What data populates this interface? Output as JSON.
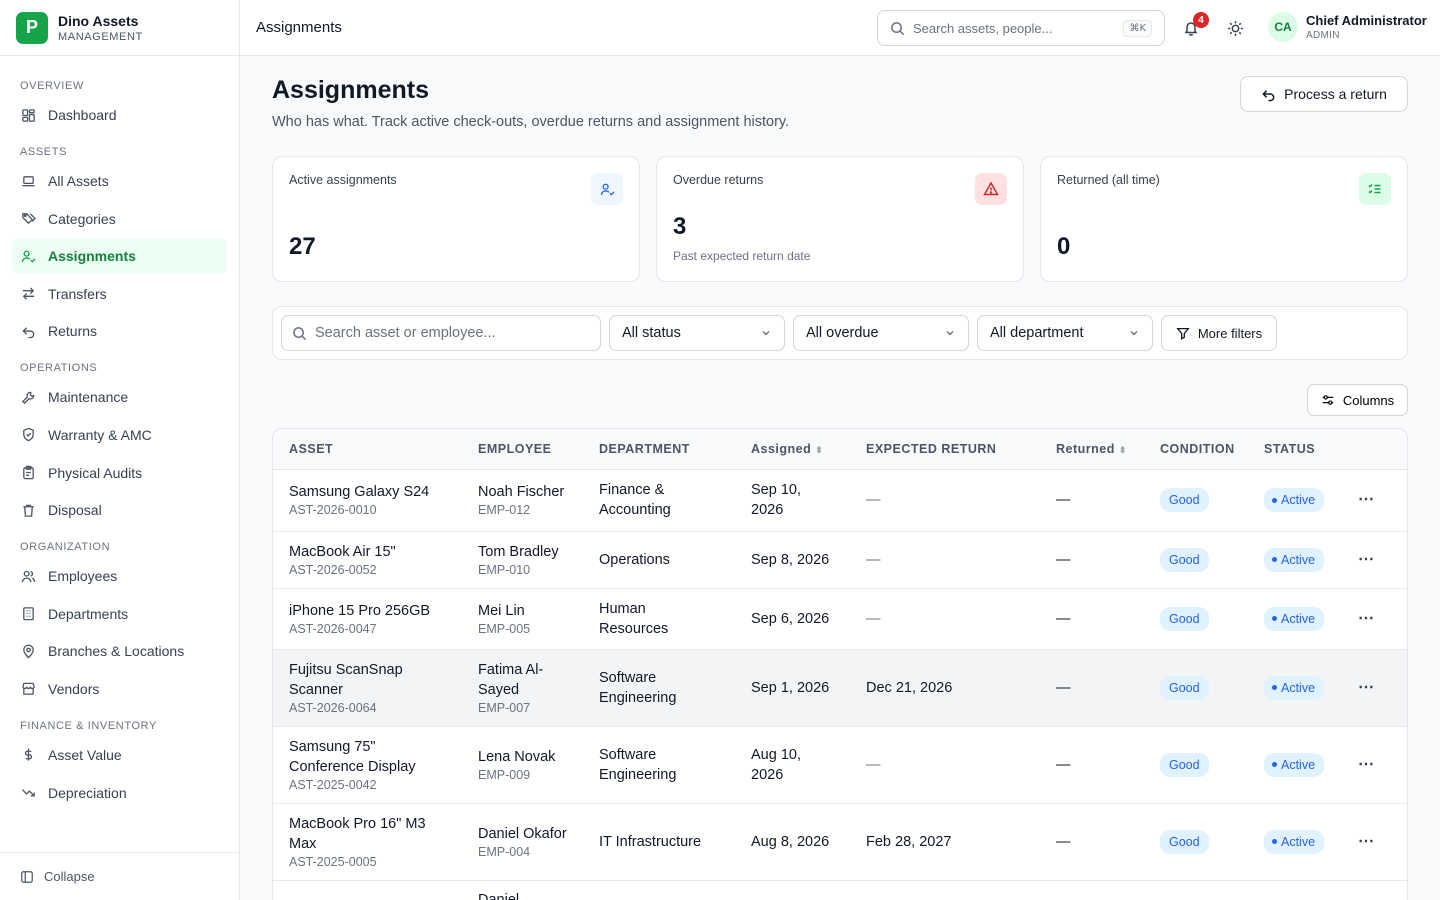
{
  "brand": {
    "logo_letter": "P",
    "name": "Dino Assets",
    "tagline": "MANAGEMENT"
  },
  "sidebar": {
    "sections": [
      {
        "title": "OVERVIEW",
        "items": [
          {
            "label": "Dashboard",
            "icon": "dashboard-icon"
          }
        ]
      },
      {
        "title": "ASSETS",
        "items": [
          {
            "label": "All Assets",
            "icon": "laptop-icon"
          },
          {
            "label": "Categories",
            "icon": "tags-icon"
          },
          {
            "label": "Assignments",
            "icon": "user-check-icon",
            "active": true
          },
          {
            "label": "Transfers",
            "icon": "arrows-icon"
          },
          {
            "label": "Returns",
            "icon": "undo-icon"
          }
        ]
      },
      {
        "title": "OPERATIONS",
        "items": [
          {
            "label": "Maintenance",
            "icon": "wrench-icon"
          },
          {
            "label": "Warranty & AMC",
            "icon": "shield-icon"
          },
          {
            "label": "Physical Audits",
            "icon": "clipboard-icon"
          },
          {
            "label": "Disposal",
            "icon": "trash-icon"
          }
        ]
      },
      {
        "title": "ORGANIZATION",
        "items": [
          {
            "label": "Employees",
            "icon": "users-icon"
          },
          {
            "label": "Departments",
            "icon": "building-icon"
          },
          {
            "label": "Branches & Locations",
            "icon": "map-pin-icon"
          },
          {
            "label": "Vendors",
            "icon": "store-icon"
          }
        ]
      },
      {
        "title": "FINANCE & INVENTORY",
        "items": [
          {
            "label": "Asset Value",
            "icon": "dollar-icon"
          },
          {
            "label": "Depreciation",
            "icon": "trending-down-icon"
          }
        ]
      }
    ],
    "collapse_label": "Collapse"
  },
  "header": {
    "breadcrumb": "Assignments",
    "search_placeholder": "Search assets, people...",
    "shortcut": "⌘K",
    "notification_count": "4",
    "user_initials": "CA",
    "user_name": "Chief Administrator",
    "user_role": "ADMIN"
  },
  "page": {
    "title": "Assignments",
    "subtitle": "Who has what. Track active check-outs, overdue returns and assignment history.",
    "process_return_label": "Process a return"
  },
  "stats": [
    {
      "label": "Active assignments",
      "value": "27",
      "note": "",
      "icon": "user-check-icon",
      "tone": "#eff6ff",
      "ink": "#2563eb"
    },
    {
      "label": "Overdue returns",
      "value": "3",
      "note": "Past expected return date",
      "icon": "alert-triangle-icon",
      "tone": "#fee2e2",
      "ink": "#dc2626"
    },
    {
      "label": "Returned (all time)",
      "value": "0",
      "note": "",
      "icon": "list-check-icon",
      "tone": "#dcfce7",
      "ink": "#16a34a"
    }
  ],
  "filters": {
    "search_placeholder": "Search asset or employee...",
    "status": "All status",
    "overdue": "All overdue",
    "department": "All department",
    "more_label": "More filters"
  },
  "columns_label": "Columns",
  "table": {
    "headers": [
      "ASSET",
      "EMPLOYEE",
      "DEPARTMENT",
      "Assigned",
      "EXPECTED RETURN",
      "Returned",
      "CONDITION",
      "STATUS"
    ],
    "rows": [
      {
        "asset": "Samsung Galaxy S24",
        "asset_id": "AST-2026-0010",
        "employee": "Noah Fischer",
        "emp_id": "EMP-012",
        "department": "Finance & Accounting",
        "assigned": "Sep 10, 2026",
        "expected": "—",
        "returned": "—",
        "condition": "Good",
        "status": "Active"
      },
      {
        "asset": "MacBook Air 15\"",
        "asset_id": "AST-2026-0052",
        "employee": "Tom Bradley",
        "emp_id": "EMP-010",
        "department": "Operations",
        "assigned": "Sep 8, 2026",
        "expected": "—",
        "returned": "—",
        "condition": "Good",
        "status": "Active"
      },
      {
        "asset": "iPhone 15 Pro 256GB",
        "asset_id": "AST-2026-0047",
        "employee": "Mei Lin",
        "emp_id": "EMP-005",
        "department": "Human Resources",
        "assigned": "Sep 6, 2026",
        "expected": "—",
        "returned": "—",
        "condition": "Good",
        "status": "Active"
      },
      {
        "asset": "Fujitsu ScanSnap Scanner",
        "asset_id": "AST-2026-0064",
        "employee": "Fatima Al-Sayed",
        "emp_id": "EMP-007",
        "department": "Software Engineering",
        "assigned": "Sep 1, 2026",
        "expected": "Dec 21, 2026",
        "returned": "—",
        "condition": "Good",
        "status": "Active",
        "highlight": true
      },
      {
        "asset": "Samsung 75\" Conference Display",
        "asset_id": "AST-2025-0042",
        "employee": "Lena Novak",
        "emp_id": "EMP-009",
        "department": "Software Engineering",
        "assigned": "Aug 10, 2026",
        "expected": "—",
        "returned": "—",
        "condition": "Good",
        "status": "Active"
      },
      {
        "asset": "MacBook Pro 16\" M3 Max",
        "asset_id": "AST-2025-0005",
        "employee": "Daniel Okafor",
        "emp_id": "EMP-004",
        "department": "IT Infrastructure",
        "assigned": "Aug 8, 2026",
        "expected": "Feb 28, 2027",
        "returned": "—",
        "condition": "Good",
        "status": "Active"
      },
      {
        "asset": "",
        "asset_id": "",
        "employee": "Daniel",
        "emp_id": "",
        "department": "",
        "assigned": "",
        "expected": "",
        "returned": "",
        "condition": "",
        "status": ""
      }
    ]
  }
}
